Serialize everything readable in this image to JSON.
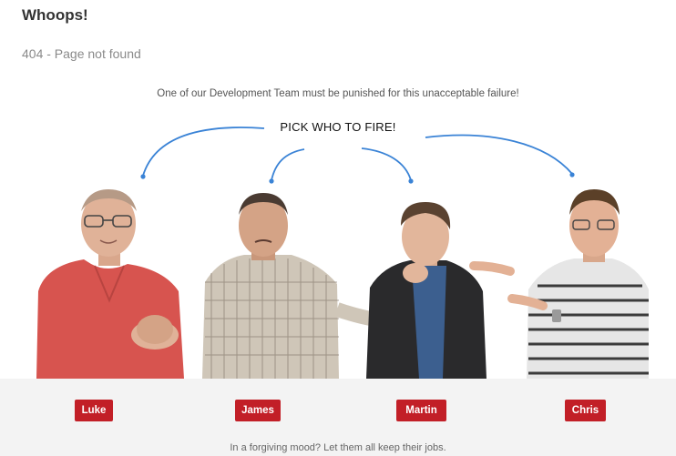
{
  "header": {
    "title": "Whoops!",
    "subtitle": "404 - Page not found"
  },
  "main": {
    "lead_text": "One of our Development Team must be punished for this unacceptable failure!",
    "prompt": "PICK WHO TO FIRE!",
    "people": [
      {
        "name": "Luke",
        "shirt": "polo-red"
      },
      {
        "name": "James",
        "shirt": "plaid"
      },
      {
        "name": "Martin",
        "shirt": "black-jacket"
      },
      {
        "name": "Chris",
        "shirt": "striped-polo"
      }
    ],
    "forgive_link": "In a forgiving mood? Let them all keep their jobs."
  },
  "colors": {
    "accent_button": "#c21f27",
    "arrow": "#3a83d6",
    "footer_band": "#f3f3f3"
  }
}
